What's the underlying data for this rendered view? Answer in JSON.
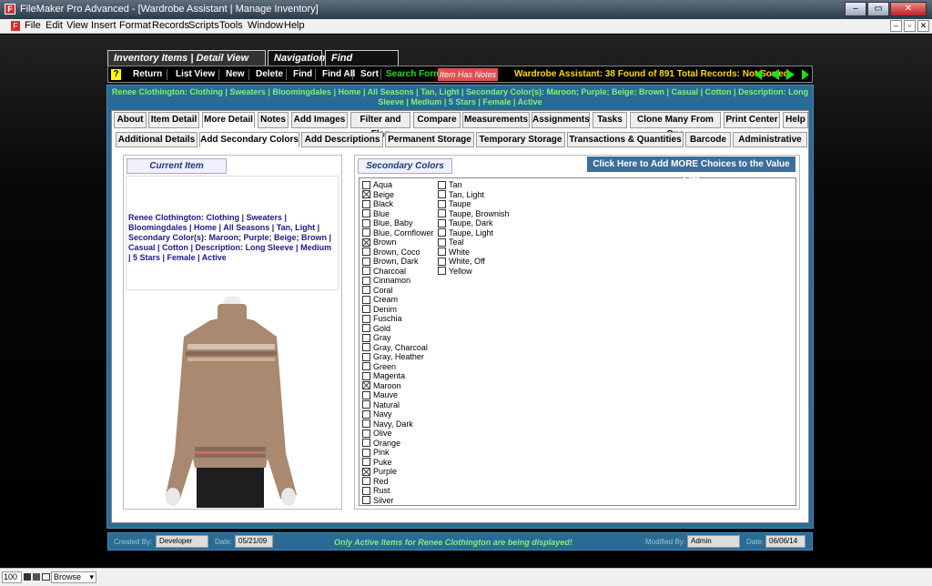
{
  "window": {
    "title": "FileMaker Pro Advanced - [Wardrobe Assistant | Manage Inventory]",
    "min": "–",
    "max": "▭",
    "close": "✕",
    "mdi_min": "–",
    "mdi_max": "▫",
    "mdi_close": "✕"
  },
  "menu": [
    "File",
    "Edit",
    "View",
    "Insert",
    "Format",
    "Records",
    "Scripts",
    "Tools",
    "Window",
    "Help"
  ],
  "toolbar_tabs": [
    "Inventory Items | Detail View Toolbar",
    "Navigation",
    "Find Functions"
  ],
  "toolbar": {
    "help": "?",
    "return": "Return",
    "list_view": "List View",
    "new": "New",
    "delete": "Delete",
    "find": "Find",
    "find_all": "Find All",
    "sort": "Sort",
    "search_form": "Search Form",
    "item_has_notes": "Item Has Notes",
    "found_status": "Wardrobe Assistant:  38 Found of 891 Total Records: Not Sorted"
  },
  "banner": "Renee Clothington: Clothing | Sweaters | Bloomingdales | Home | All Seasons | Tan, Light | Secondary Color(s): Maroon; Purple; Beige; Brown | Casual | Cotton | Description: Long Sleeve | Medium | 5 Stars | Female | Active",
  "primary_tabs": [
    "About",
    "Item Detail",
    "More Detail",
    "Notes",
    "Add Images",
    "Filter and Flag",
    "Compare",
    "Measurements",
    "Assignments",
    "Tasks",
    "Clone Many From One",
    "Print Center",
    "Help"
  ],
  "secondary_tabs": [
    "Additional Details",
    "Add Secondary Colors",
    "Add Descriptions",
    "Permanent Storage",
    "Temporary Storage",
    "Transactions & Quantities",
    "Barcode",
    "Administrative"
  ],
  "current_item": {
    "header": "Current Item",
    "description": "Renee Clothington: Clothing | Sweaters | Bloomingdales | Home | All Seasons | Tan, Light | Secondary Color(s): Maroon; Purple; Beige; Brown | Casual | Cotton | Description: Long Sleeve | Medium | 5 Stars | Female | Active"
  },
  "secondary_colors": {
    "header": "Secondary Colors",
    "add_button": "Click Here to Add MORE Choices to  the Value List",
    "col1": [
      [
        "Aqua",
        false
      ],
      [
        "Beige",
        true
      ],
      [
        "Black",
        false
      ],
      [
        "Blue",
        false
      ],
      [
        "Blue, Baby",
        false
      ],
      [
        "Blue, Cornflower",
        false
      ],
      [
        "Brown",
        true
      ],
      [
        "Brown, Coco",
        false
      ],
      [
        "Brown, Dark",
        false
      ],
      [
        "Charcoal",
        false
      ],
      [
        "Cinnamon",
        false
      ],
      [
        "Coral",
        false
      ],
      [
        "Cream",
        false
      ],
      [
        "Denim",
        false
      ],
      [
        "Fuschia",
        false
      ],
      [
        "Gold",
        false
      ],
      [
        "Gray",
        false
      ],
      [
        "Gray, Charcoal",
        false
      ],
      [
        "Gray, Heather",
        false
      ],
      [
        "Green",
        false
      ],
      [
        "Magenta",
        false
      ],
      [
        "Maroon",
        true
      ],
      [
        "Mauve",
        false
      ],
      [
        "Natural",
        false
      ],
      [
        "Navy",
        false
      ],
      [
        "Navy, Dark",
        false
      ],
      [
        "Olive",
        false
      ],
      [
        "Orange",
        false
      ],
      [
        "Pink",
        false
      ],
      [
        "Puke",
        false
      ],
      [
        "Purple",
        true
      ],
      [
        "Red",
        false
      ],
      [
        "Rust",
        false
      ],
      [
        "Silver",
        false
      ]
    ],
    "col2": [
      [
        "Tan",
        false
      ],
      [
        "Tan, Light",
        false
      ],
      [
        "Taupe",
        false
      ],
      [
        "Taupe, Brownish",
        false
      ],
      [
        "Taupe, Dark",
        false
      ],
      [
        "Taupe, Light",
        false
      ],
      [
        "Teal",
        false
      ],
      [
        "White",
        false
      ],
      [
        "White, Off",
        false
      ],
      [
        "Yellow",
        false
      ]
    ]
  },
  "footer": {
    "created_by_label": "Created By:",
    "created_by": "Developer",
    "date_label": "Date:",
    "created_date": "05/21/09",
    "message": "Only Active Items for Renee Clothington are being displayed!",
    "modified_by_label": "Modified By:",
    "modified_by": "Admin",
    "modified_date": "06/06/14"
  },
  "status": {
    "zoom": "100",
    "mode": "Browse"
  },
  "colors": {
    "panel": "#2a6a96",
    "banner_text": "#7ff07f",
    "notes_badge": "#e05050",
    "found_text": "#ffd700",
    "nav_arrows": "#22dd22"
  }
}
